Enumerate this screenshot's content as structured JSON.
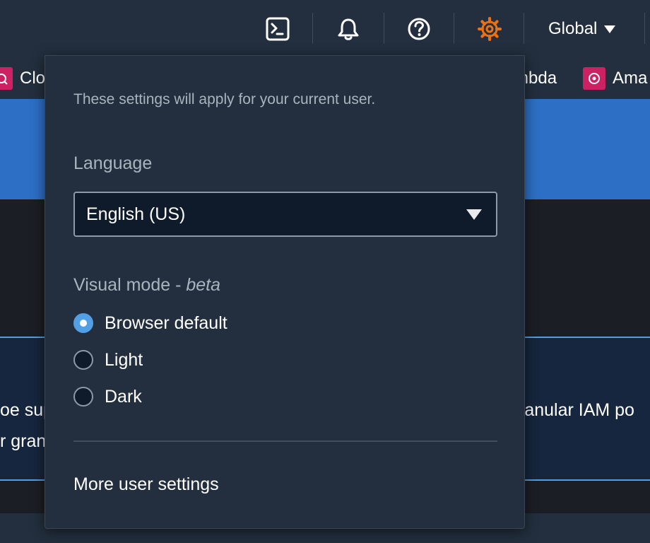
{
  "topnav": {
    "region_label": "Global",
    "icons": [
      "cloudshell-icon",
      "bell-icon",
      "help-icon",
      "gear-icon"
    ],
    "active_icon_color": "#ec7211"
  },
  "favorites": {
    "items": [
      {
        "label": "Clo",
        "icon": "cloud-service-icon"
      },
      {
        "label": "mbda",
        "icon": "lambda-service-icon"
      },
      {
        "label": "Ama",
        "icon": "amazon-service-icon"
      }
    ],
    "badge_color": "#cc2264"
  },
  "background": {
    "info_lines_left": [
      "oe sup",
      "r gran"
    ],
    "info_lines_right": [
      "ranular IAM po"
    ]
  },
  "settings": {
    "description": "These settings will apply for your current user.",
    "language_label": "Language",
    "language_value": "English (US)",
    "visual_mode_label": "Visual mode - ",
    "visual_mode_suffix": "beta",
    "visual_mode_options": [
      {
        "label": "Browser default",
        "checked": true
      },
      {
        "label": "Light",
        "checked": false
      },
      {
        "label": "Dark",
        "checked": false
      }
    ],
    "more_link": "More user settings"
  },
  "colors": {
    "accent_blue": "#539fe5",
    "nav_bg": "#232f3e"
  }
}
